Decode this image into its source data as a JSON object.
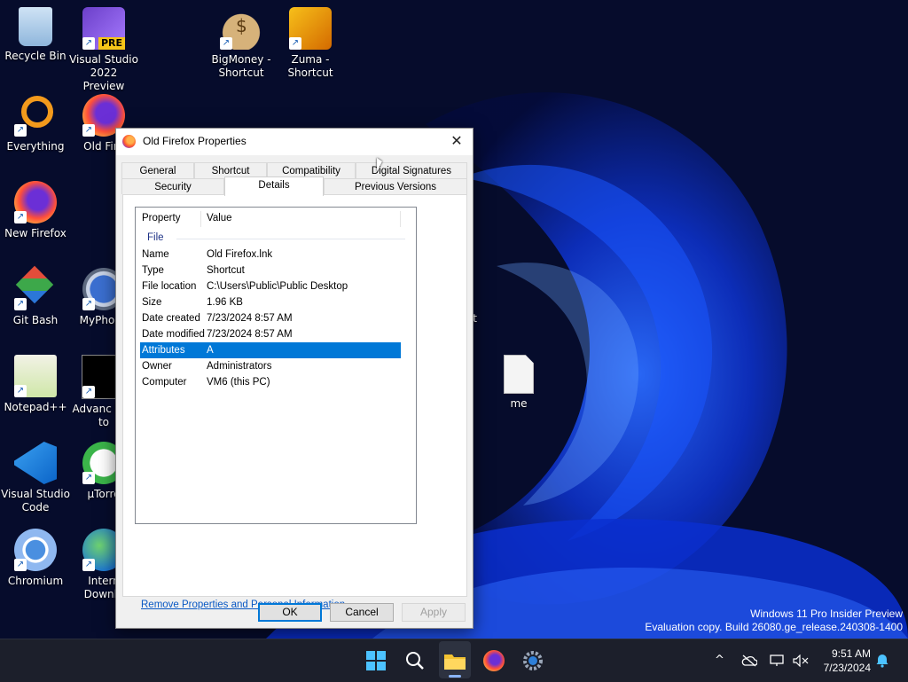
{
  "desktop": {
    "icons": [
      {
        "label": "Recycle Bin",
        "icon": "recycle-bin-icon"
      },
      {
        "label": "Visual Studio 2022 Preview",
        "icon": "visual-studio-preview-icon",
        "badge": "PRE"
      },
      {
        "label": "BigMoney - Shortcut",
        "icon": "money-bag-icon"
      },
      {
        "label": "Zuma - Shortcut",
        "icon": "zuma-icon"
      },
      {
        "label": "Everything",
        "icon": "magnifier-icon"
      },
      {
        "label": "Old Fire",
        "icon": "firefox-icon"
      },
      {
        "label": "New Firefox",
        "icon": "firefox-icon"
      },
      {
        "label": "Git Bash",
        "icon": "git-bash-icon"
      },
      {
        "label": "MyPhone",
        "icon": "sync-icon"
      },
      {
        "label": "Notepad++",
        "icon": "notepadpp-icon"
      },
      {
        "label": "Advanc BAT to",
        "icon": "bat-to-exe-icon"
      },
      {
        "label": "Visual Studio Code",
        "icon": "vscode-icon"
      },
      {
        "label": "µTorre",
        "icon": "utorrent-icon"
      },
      {
        "label": "Chromium",
        "icon": "chromium-icon"
      },
      {
        "label": "Intern Downlo",
        "icon": "internet-download-icon"
      },
      {
        "label": "me",
        "icon": "text-file-icon"
      },
      {
        "label": "t",
        "icon": "partial-label"
      }
    ]
  },
  "watermark": {
    "line1": "Windows 11 Pro Insider Preview",
    "line2": "Evaluation copy. Build 26080.ge_release.240308-1400"
  },
  "dialog": {
    "title": "Old Firefox Properties",
    "close_glyph": "✕",
    "tabs_row1": [
      "General",
      "Shortcut",
      "Compatibility",
      "Digital Signatures"
    ],
    "tabs_row2": [
      "Security",
      "Details",
      "Previous Versions"
    ],
    "active_tab": "Details",
    "columns": {
      "property": "Property",
      "value": "Value"
    },
    "group": "File",
    "rows": [
      {
        "property": "Name",
        "value": "Old Firefox.lnk"
      },
      {
        "property": "Type",
        "value": "Shortcut"
      },
      {
        "property": "File location",
        "value": "C:\\Users\\Public\\Public Desktop"
      },
      {
        "property": "Size",
        "value": "1.96 KB"
      },
      {
        "property": "Date created",
        "value": "7/23/2024 8:57 AM"
      },
      {
        "property": "Date modified",
        "value": "7/23/2024 8:57 AM"
      },
      {
        "property": "Attributes",
        "value": "A",
        "selected": true
      },
      {
        "property": "Owner",
        "value": "Administrators"
      },
      {
        "property": "Computer",
        "value": "VM6 (this PC)"
      }
    ],
    "link": "Remove Properties and Personal Information",
    "buttons": {
      "ok": "OK",
      "cancel": "Cancel",
      "apply": "Apply"
    }
  },
  "taskbar": {
    "items": [
      "start-icon",
      "search-icon",
      "file-explorer-icon",
      "firefox-icon",
      "settings-icon"
    ],
    "running": "file-explorer-icon",
    "tray": {
      "chevron": "^",
      "time": "9:51 AM",
      "date": "7/23/2024"
    }
  },
  "colors": {
    "selection": "#0078d7",
    "link": "#0a59c4",
    "taskbar": "#1c1f2b",
    "wallpaper_accent": "#1f4bff"
  }
}
